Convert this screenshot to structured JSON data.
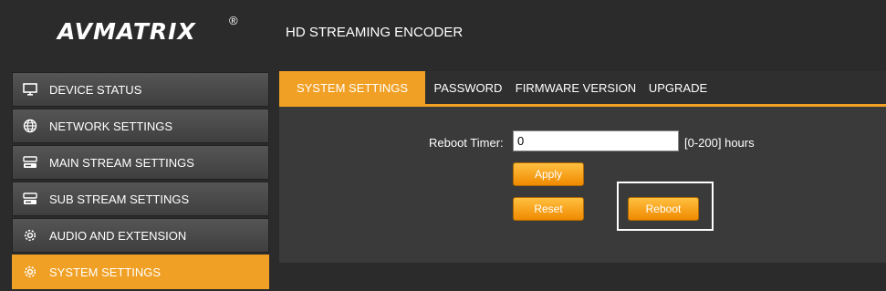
{
  "header": {
    "logo": "AVMATRIX",
    "logo_mark": "®",
    "title": "HD STREAMING ENCODER"
  },
  "sidebar": {
    "items": [
      {
        "label": "DEVICE STATUS",
        "icon": "monitor-icon"
      },
      {
        "label": "NETWORK SETTINGS",
        "icon": "globe-icon"
      },
      {
        "label": "MAIN STREAM SETTINGS",
        "icon": "hard-drive-icon"
      },
      {
        "label": "SUB STREAM SETTINGS",
        "icon": "hard-drive-icon"
      },
      {
        "label": "AUDIO AND EXTENSION",
        "icon": "gear-icon"
      },
      {
        "label": "SYSTEM SETTINGS",
        "icon": "gear-icon"
      }
    ],
    "active_index": 5
  },
  "tabs": [
    "SYSTEM SETTINGS",
    "PASSWORD",
    "FIRMWARE VERSION",
    "UPGRADE"
  ],
  "form": {
    "reboot_timer_label": "Reboot Timer:",
    "reboot_timer_value": "0",
    "reboot_timer_hint": "[0-200] hours"
  },
  "buttons": {
    "apply": "Apply",
    "reset": "Reset",
    "reboot": "Reboot"
  },
  "colors": {
    "accent": "#f0a024",
    "background": "#2b2b2b"
  }
}
